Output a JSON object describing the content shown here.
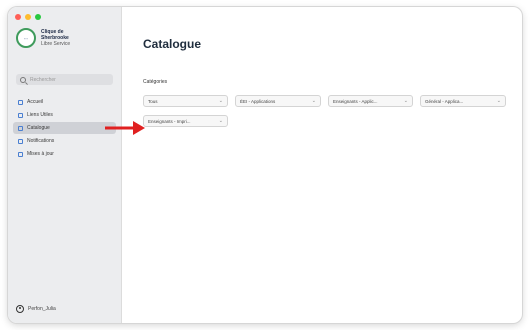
{
  "window": {
    "controls": [
      "close",
      "minimize",
      "zoom"
    ]
  },
  "brand": {
    "line1": "Clique de",
    "line2": "Sherbrooke",
    "line3": "Libre Service"
  },
  "search": {
    "placeholder": "Rechercher"
  },
  "nav": {
    "items": [
      {
        "label": "Accueil",
        "icon": "home-icon"
      },
      {
        "label": "Liens Utiles",
        "icon": "link-icon"
      },
      {
        "label": "Catalogue",
        "icon": "catalog-icon",
        "active": true
      },
      {
        "label": "Notifications",
        "icon": "bell-icon"
      },
      {
        "label": "Mises à jour",
        "icon": "update-icon"
      }
    ]
  },
  "user": {
    "name": "Perfon_Julia"
  },
  "main": {
    "title": "Catalogue",
    "categories_label": "Catégories",
    "chips": [
      {
        "label": "Tous"
      },
      {
        "label": "ÉEI - Applications"
      },
      {
        "label": "Enseignants - Applic..."
      },
      {
        "label": "Général - Applica..."
      },
      {
        "label": "Enseignants - Impri..."
      }
    ]
  },
  "annotation": {
    "arrow_color": "#e02020"
  }
}
